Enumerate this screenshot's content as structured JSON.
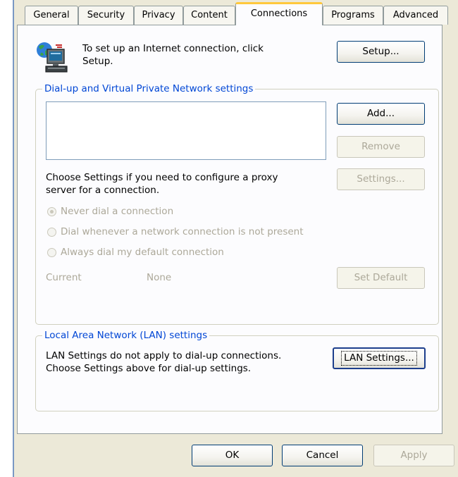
{
  "tabs": [
    {
      "label": "General"
    },
    {
      "label": "Security"
    },
    {
      "label": "Privacy"
    },
    {
      "label": "Content"
    },
    {
      "label": "Connections",
      "active": true
    },
    {
      "label": "Programs"
    },
    {
      "label": "Advanced"
    }
  ],
  "setup": {
    "icon": "network-globe-computer-icon",
    "text_line1": "To set up an Internet connection, click",
    "text_line2": "Setup.",
    "button": "Setup..."
  },
  "dialup": {
    "title": "Dial-up and Virtual Private Network settings",
    "connections": [],
    "add_button": "Add...",
    "remove_button": "Remove",
    "settings_text_line1": "Choose Settings if you need to configure a proxy",
    "settings_text_line2": "server for a connection.",
    "settings_button": "Settings...",
    "radio_options": [
      {
        "label": "Never dial a connection",
        "checked": true
      },
      {
        "label": "Dial whenever a network connection is not present",
        "checked": false
      },
      {
        "label": "Always dial my default connection",
        "checked": false
      }
    ],
    "current_label": "Current",
    "current_value": "None",
    "set_default_button": "Set Default"
  },
  "lan": {
    "title": "Local Area Network (LAN) settings",
    "text_line1": "LAN Settings do not apply to dial-up connections.",
    "text_line2": "Choose Settings above for dial-up settings.",
    "button": "LAN Settings..."
  },
  "footer": {
    "ok": "OK",
    "cancel": "Cancel",
    "apply": "Apply"
  },
  "colors": {
    "group_title": "#0046d5",
    "active_tab_highlight": "#ffc83c",
    "dialog_background": "#ece9d8",
    "disabled_text": "#aca899"
  }
}
